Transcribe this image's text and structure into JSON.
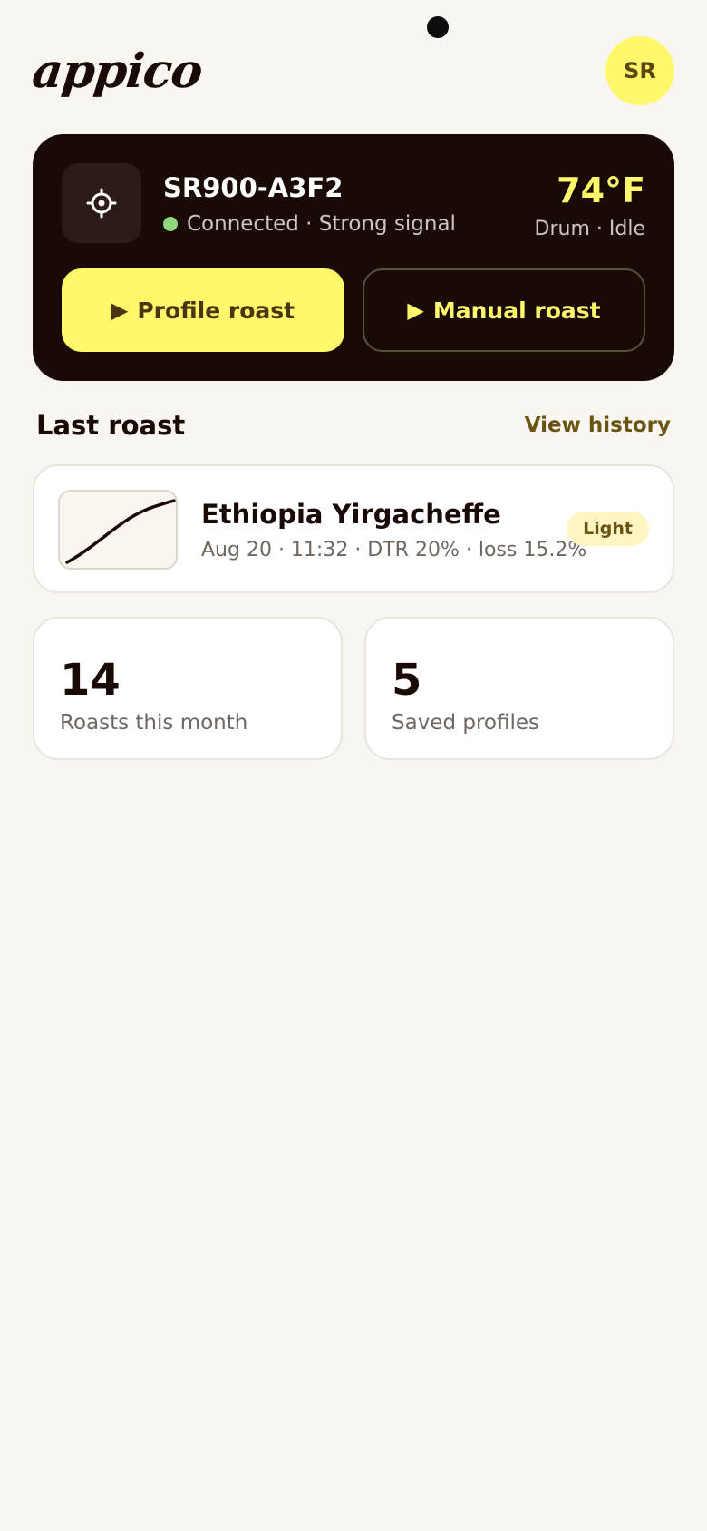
{
  "app": {
    "logo": "appico",
    "avatar_initials": "SR"
  },
  "device": {
    "name": "SR900-A3F2",
    "status": "Connected · Strong signal",
    "temperature": "74°F",
    "state": "Drum · Idle",
    "icon": "gear-icon",
    "status_color": "#8fd67f"
  },
  "actions": {
    "profile_roast": "Profile roast",
    "manual_roast": "Manual roast"
  },
  "last_roast_section": {
    "title": "Last roast",
    "link": "View history"
  },
  "last_roast": {
    "name": "Ethiopia Yirgacheffe",
    "meta": "Aug 20 · 11:32 · DTR 20% · loss 15.2%",
    "roast_level": "Light"
  },
  "stats": [
    {
      "value": "14",
      "label": "Roasts this month"
    },
    {
      "value": "5",
      "label": "Saved profiles"
    }
  ],
  "colors": {
    "background": "#f9f6f1",
    "dark": "#1a0a06",
    "accent": "#fff86a"
  }
}
